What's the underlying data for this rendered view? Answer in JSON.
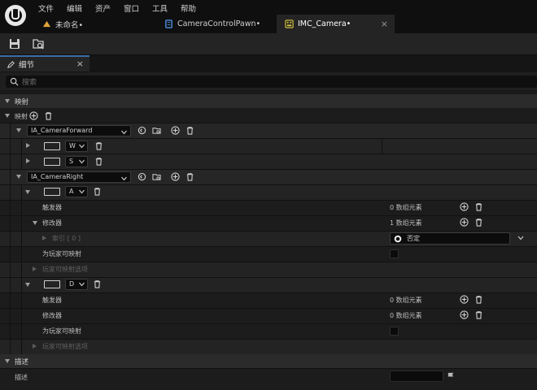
{
  "menu": [
    "文件",
    "编辑",
    "资产",
    "窗口",
    "工具",
    "帮助"
  ],
  "tabs": [
    {
      "label": "未命名•",
      "icon": "level-icon",
      "color": "#e0a33a"
    },
    {
      "label": "CameraControlPawn•",
      "icon": "blueprint-icon",
      "color": "#4f8fdc"
    },
    {
      "label": "IMC_Camera•",
      "icon": "input-mapping-icon",
      "color": "#d9c640",
      "active": true
    }
  ],
  "details": {
    "tab_label": "细节",
    "search_placeholder": "搜索",
    "sections": {
      "mappings": "映射",
      "description": "描述"
    },
    "mappings_label": "映射",
    "actions": [
      {
        "name": "IA_CameraForward",
        "keys": [
          "W",
          "S"
        ]
      },
      {
        "name": "IA_CameraRight",
        "keys": [
          {
            "key": "A",
            "triggers_label": "触发器",
            "triggers_value": "0 数组元素",
            "modifiers_label": "修改器",
            "modifiers_value": "1 数组元素",
            "index_label": "索引 [ 0 ]",
            "index_value": "否定",
            "player_mappable_label": "为玩家可映射",
            "player_options_label": "玩家可映射选项"
          },
          {
            "key": "D",
            "triggers_label": "触发器",
            "triggers_value": "0 数组元素",
            "modifiers_label": "修改器",
            "modifiers_value": "0 数组元素",
            "player_mappable_label": "为玩家可映射",
            "player_options_label": "玩家可映射选项"
          }
        ]
      }
    ],
    "description_label": "描述"
  },
  "colors": {
    "accent": "#3c6ea8",
    "panel_bg": "#1a1a1a"
  }
}
